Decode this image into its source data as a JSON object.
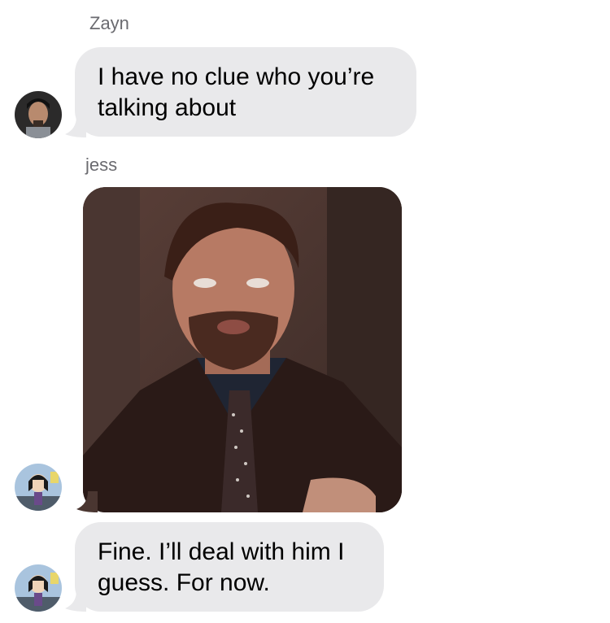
{
  "messages": [
    {
      "sender": "Zayn",
      "type": "text",
      "text": "I have no clue who you’re talking about"
    },
    {
      "sender": "jess",
      "type": "image",
      "image_description_icon": "reaction-meme-image"
    },
    {
      "sender": "",
      "type": "text",
      "text": "Fine. I’ll deal with him I guess. For now."
    }
  ],
  "colors": {
    "bubble_received": "#e9e9eb",
    "sender_name": "#6b6b70",
    "background": "#ffffff"
  }
}
